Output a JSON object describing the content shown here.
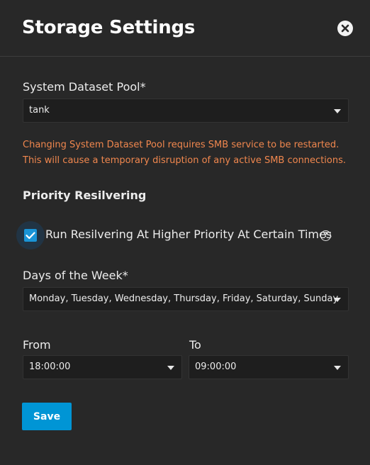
{
  "dialog": {
    "title": "Storage Settings",
    "close_icon": "close-circle-icon"
  },
  "pool": {
    "label": "System Dataset Pool",
    "required_mark": "*",
    "value": "tank",
    "warning": "Changing System Dataset Pool requires SMB service to be restarted. This will cause a temporary disruption of any active SMB connections."
  },
  "resilver": {
    "section_title": "Priority Resilvering",
    "checkbox_label": "Run Resilvering At Higher Priority At Certain Times",
    "checked": true,
    "help_icon": "help-circle-icon",
    "help_glyph": "?"
  },
  "days": {
    "label": "Days of the Week",
    "required_mark": "*",
    "value": "Monday, Tuesday, Wednesday, Thursday, Friday, Saturday, Sunday"
  },
  "from": {
    "label": "From",
    "value": "18:00:00"
  },
  "to": {
    "label": "To",
    "value": "09:00:00"
  },
  "actions": {
    "save_label": "Save"
  },
  "colors": {
    "background": "#282828",
    "accent": "#0095d5",
    "warning": "#f0874e",
    "checkbox": "#1a94d6"
  }
}
